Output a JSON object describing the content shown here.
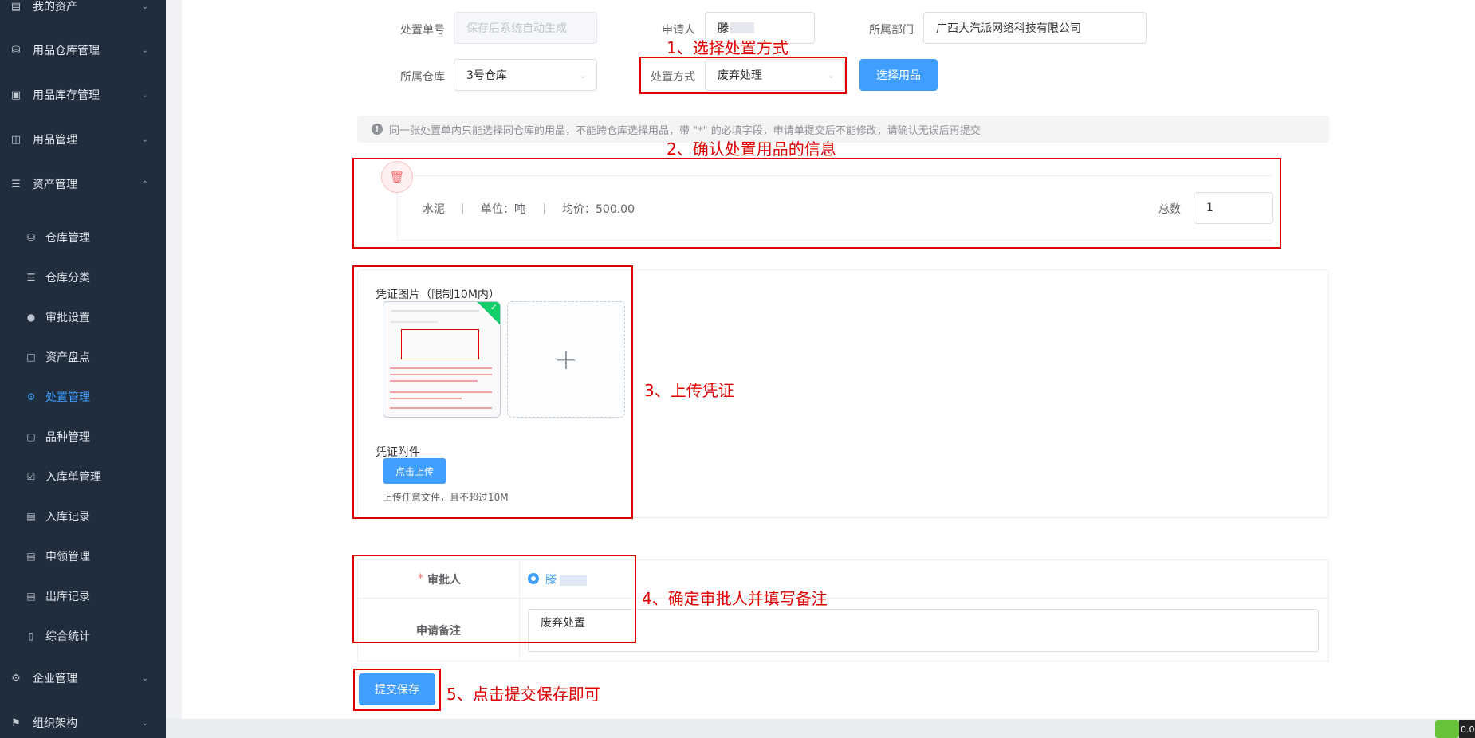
{
  "sidebar": {
    "top_items": [
      {
        "label": "我的资产",
        "icon": "asset-icon"
      },
      {
        "label": "用品仓库管理",
        "icon": "database-icon"
      },
      {
        "label": "用品库存管理",
        "icon": "box-icon"
      },
      {
        "label": "用品管理",
        "icon": "inbox-icon"
      },
      {
        "label": "资产管理",
        "icon": "stack-icon"
      }
    ],
    "sub_items": [
      {
        "label": "仓库管理",
        "icon": "database-icon"
      },
      {
        "label": "仓库分类",
        "icon": "sliders-icon"
      },
      {
        "label": "审批设置",
        "icon": "user-icon"
      },
      {
        "label": "资产盘点",
        "icon": "document-icon"
      },
      {
        "label": "处置管理",
        "icon": "gear-icon",
        "active": true
      },
      {
        "label": "品种管理",
        "icon": "bag-icon"
      },
      {
        "label": "入库单管理",
        "icon": "clipboard-check-icon"
      },
      {
        "label": "入库记录",
        "icon": "clipboard-icon"
      },
      {
        "label": "申领管理",
        "icon": "clipboard-icon"
      },
      {
        "label": "出库记录",
        "icon": "clipboard-icon"
      },
      {
        "label": "综合统计",
        "icon": "bar-chart-icon"
      }
    ],
    "bottom_items": [
      {
        "label": "企业管理",
        "icon": "gear-icon"
      },
      {
        "label": "组织架构",
        "icon": "flag-icon"
      }
    ]
  },
  "form": {
    "order_no_label": "处置单号",
    "order_no_placeholder": "保存后系统自动生成",
    "applicant_label": "申请人",
    "applicant_value": "滕",
    "dept_label": "所属部门",
    "dept_value": "广西大汽派网络科技有限公司",
    "warehouse_label": "所属仓库",
    "warehouse_value": "3号仓库",
    "method_label": "处置方式",
    "method_value": "废弃处理",
    "select_button": "选择用品"
  },
  "notice": "同一张处置单内只能选择同仓库的用品，不能跨仓库选择用品，带 \"*\" 的必填字段，申请单提交后不能修改，请确认无误后再提交",
  "item": {
    "name": "水泥",
    "unit": "单位：吨",
    "price": "均价：500.00",
    "total_label": "总数",
    "total_value": "1"
  },
  "upload": {
    "image_label": "凭证图片（限制10M内）",
    "attach_label": "凭证附件",
    "attach_button": "点击上传",
    "attach_hint": "上传任意文件，且不超过10M"
  },
  "approval": {
    "required_mark": "*",
    "approver_label": "审批人",
    "approver_name": "滕",
    "remark_label": "申请备注",
    "remark_value": "废弃处置"
  },
  "submit_button": "提交保存",
  "annotations": {
    "step1": "1、选择处置方式",
    "step2": "2、确认处置用品的信息",
    "step3": "3、上传凭证",
    "step4": "4、确定审批人并填写备注",
    "step5": "5、点击提交保存即可"
  },
  "corner_text": "0.0",
  "colors": {
    "primary": "#409eff",
    "sidebar_bg": "#1f2d3d",
    "annotation": "#e00000"
  }
}
